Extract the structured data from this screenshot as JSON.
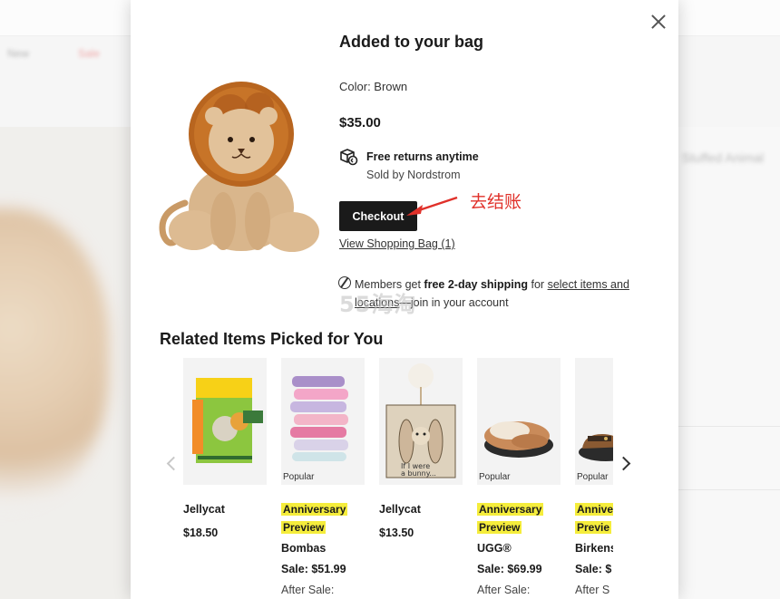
{
  "modal": {
    "title": "Added to your bag",
    "color_label": "Color: Brown",
    "price": "$35.00",
    "returns_label": "Free returns anytime",
    "sold_by": "Sold by Nordstrom",
    "checkout_label": "Checkout",
    "annotation": "去结账",
    "view_bag_label": "View Shopping Bag (1)",
    "members": {
      "prefix": "Members get ",
      "bold": "free 2-day shipping",
      "middle": " for ",
      "link": "select items and locations",
      "suffix": "—join in your account"
    },
    "watermark": "55海淘",
    "related_title": "Related Items Picked for You"
  },
  "related_items": [
    {
      "brand": "Jellycat",
      "price": "$18.50",
      "badge_1": "",
      "badge_2": "",
      "popular": "",
      "after": ""
    },
    {
      "brand": "Bombas",
      "price": "Sale: $51.99",
      "badge_1": "Anniversary",
      "badge_2": "Preview",
      "popular": "Popular",
      "after": "After Sale:"
    },
    {
      "brand": "Jellycat",
      "price": "$13.50",
      "badge_1": "",
      "badge_2": "",
      "popular": "",
      "after": ""
    },
    {
      "brand": "UGG®",
      "price": "Sale: $69.99",
      "badge_1": "Anniversary",
      "badge_2": "Preview",
      "popular": "Popular",
      "after": "After Sale:"
    },
    {
      "brand": "Birkens",
      "price": "Sale: $",
      "badge_1": "Annive",
      "badge_2": "Previe",
      "popular": "Popular",
      "after": "After S"
    }
  ],
  "background": {
    "nav_left_1": "New",
    "nav_left_2": "Sale",
    "right_title": "Stuffed Animal"
  },
  "colors": {
    "checkout_bg": "#1a1a1a",
    "annotation": "#e0312a",
    "badge": "#f5ed3c"
  },
  "icons": [
    "close-icon",
    "returns-box-icon",
    "members-icon",
    "chevron-left-icon",
    "chevron-right-icon"
  ]
}
